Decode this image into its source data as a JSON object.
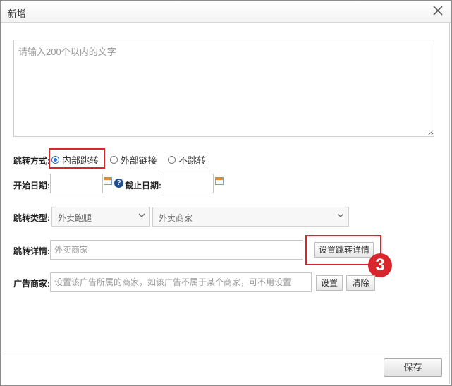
{
  "dialog": {
    "title": "新增",
    "close_icon": "close-icon"
  },
  "content": {
    "placeholder": "请输入200个以内的文字",
    "value": ""
  },
  "jump_mode": {
    "label": "跳转方式:",
    "options": [
      {
        "label": "内部跳转",
        "selected": true
      },
      {
        "label": "外部链接",
        "selected": false
      },
      {
        "label": "不跳转",
        "selected": false
      }
    ]
  },
  "dates": {
    "start_label": "开始日期:",
    "start_value": "",
    "end_label": "截止日期:",
    "end_value": "",
    "help_icon": "question-icon"
  },
  "jump_type": {
    "label": "跳转类型:",
    "select1_value": "外卖跑腿",
    "select2_value": "外卖商家"
  },
  "jump_detail": {
    "label": "跳转详情:",
    "placeholder": "外卖商家",
    "button": "设置跳转详情"
  },
  "marker": {
    "text": "3"
  },
  "ad_merchant": {
    "label": "广告商家:",
    "placeholder": "设置该广告所属的商家，如该广告不属于某个商家，可不用设置",
    "set_button": "设置",
    "clear_button": "清除"
  },
  "footer": {
    "save_button": "保存"
  },
  "colors": {
    "accent": "#2a72d8",
    "highlight": "#d9262c",
    "help": "#1d4f91"
  }
}
